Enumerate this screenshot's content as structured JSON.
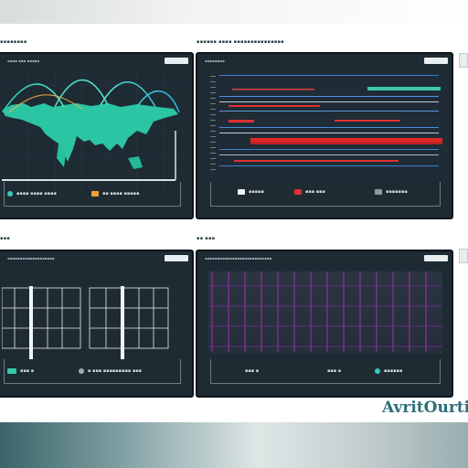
{
  "brand": {
    "logo_text": "AvritOurtic"
  },
  "panels": [
    {
      "id": "world-map-panel",
      "caption": "▪▪▪▪▪▪▪▪",
      "title": "▪▪▪▪ ▪▪▪ ▪▪▪▪▪",
      "legend": [
        {
          "label": "▪▪▪▪ ▪▪▪▪ ▪▪▪▪",
          "color": "#37c9c0",
          "marker": "dot"
        },
        {
          "label": "▪▪ ▪▪▪▪ ▪▪▪▪▪",
          "color": "#f0a030",
          "marker": "square"
        }
      ]
    },
    {
      "id": "gantt-panel",
      "caption": "▪▪▪▪▪▪ ▪▪▪▪ ▪▪▪▪▪▪▪▪▪▪▪▪▪▪▪",
      "title": "▪▪▪▪▪▪▪▪",
      "legend": [
        {
          "label": "▪▪▪▪▪",
          "color": "#f2f2f2",
          "marker": "square"
        },
        {
          "label": "▪▪▪ ▪▪▪",
          "color": "#e03030",
          "marker": "square"
        },
        {
          "label": "▪▪▪▪▪▪▪",
          "color": "#8a9aa3",
          "marker": "square"
        }
      ]
    },
    {
      "id": "table-grid-panel",
      "caption": "▪▪▪",
      "title": "▪▪▪▪▪▪▪▪▪▪▪▪▪▪▪▪▪▪▪",
      "legend": [
        {
          "label": "▪▪▪ ▪",
          "color": "#37c9a8",
          "marker": "dot"
        },
        {
          "label": "▪ ▪▪▪ ▪▪▪▪▪▪▪▪▪ ▪▪▪",
          "color": "#9ab0b8",
          "marker": "dot"
        }
      ]
    },
    {
      "id": "heat-grid-panel",
      "caption": "▪▪ ▪▪▪",
      "title": "▪▪▪▪▪▪▪▪▪▪▪▪▪▪▪▪▪▪▪▪▪▪▪▪▪▪▪",
      "legend": [
        {
          "label": "▪▪▪ ▪",
          "color": "#8a9aa3",
          "marker": "none"
        },
        {
          "label": "▪▪▪ ▪",
          "color": "#8a9aa3",
          "marker": "none"
        },
        {
          "label": "▪▪▪▪▪▪",
          "color": "#37c9c0",
          "marker": "dot"
        }
      ]
    }
  ],
  "colors": {
    "panel_bg": "#1e2b33",
    "accent_teal": "#37e0b8",
    "accent_red": "#e03030",
    "accent_magenta": "#b030c0"
  }
}
